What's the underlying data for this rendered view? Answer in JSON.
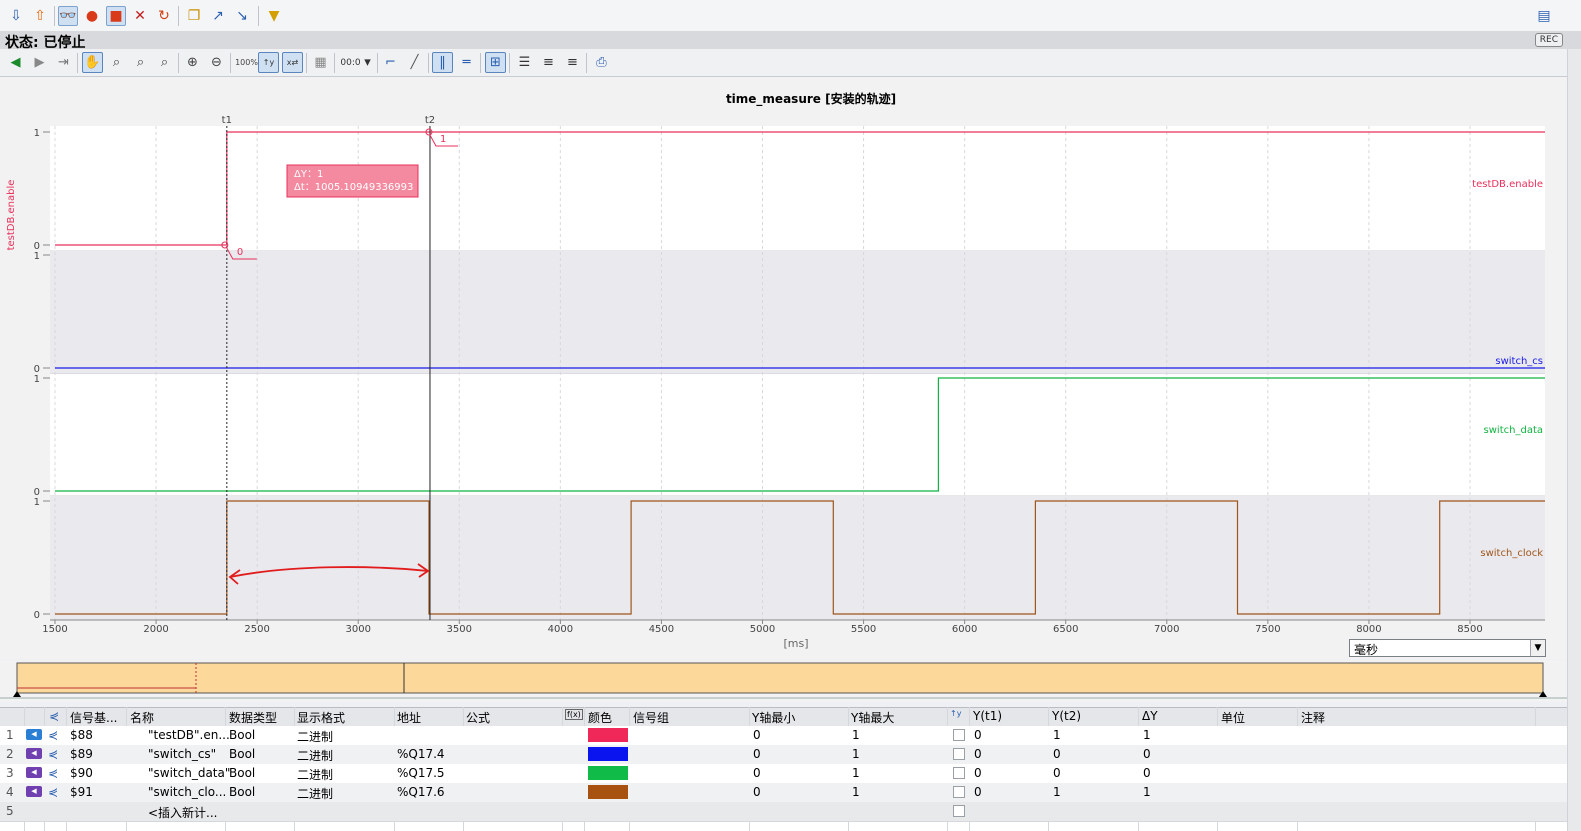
{
  "status": {
    "label": "状态: 已停止",
    "rec": "REC"
  },
  "chart": {
    "title": "time_measure [安装的轨迹]",
    "xunit": "[ms]",
    "yaxis_label": "testDB.enable",
    "x_ticks": [
      "1500",
      "2000",
      "2500",
      "3000",
      "3500",
      "4000",
      "4500",
      "5000",
      "5500",
      "6000",
      "6500",
      "7000",
      "7500",
      "8000",
      "8500"
    ],
    "cursor_t1": "t1",
    "cursor_t2": "t2",
    "t1_value": "0",
    "t2_value": "1",
    "tooltip_dy": "ΔY：1",
    "tooltip_dt": "Δt：1005.10949336993",
    "lane_ticks": {
      "one": "1",
      "zero": "0"
    },
    "signals": [
      {
        "name": "testDB.enable",
        "color": "#e8305b"
      },
      {
        "name": "switch_cs",
        "color": "#1a1ae6"
      },
      {
        "name": "switch_data",
        "color": "#10b540"
      },
      {
        "name": "switch_clock",
        "color": "#a0561a"
      }
    ],
    "unit_select": "毫秒"
  },
  "chart_data": {
    "type": "line",
    "title": "time_measure [安装的轨迹]",
    "xlabel": "[ms]",
    "xlim": [
      1500,
      8900
    ],
    "series": [
      {
        "name": "testDB.enable",
        "x": [
          1500,
          2350,
          2350,
          8900
        ],
        "y": [
          0,
          0,
          1,
          1
        ]
      },
      {
        "name": "switch_cs",
        "x": [
          1500,
          8900
        ],
        "y": [
          0,
          0
        ]
      },
      {
        "name": "switch_data",
        "x": [
          1500,
          5870,
          5870,
          8900
        ],
        "y": [
          0,
          0,
          1,
          1
        ]
      },
      {
        "name": "switch_clock",
        "x": [
          1500,
          2350,
          2350,
          3350,
          3350,
          4350,
          4350,
          5350,
          5350,
          6350,
          6350,
          7350,
          7350,
          8350,
          8350,
          8900
        ],
        "y": [
          0,
          0,
          1,
          1,
          0,
          0,
          1,
          1,
          0,
          0,
          1,
          1,
          0,
          0,
          1,
          1
        ]
      }
    ],
    "cursors": {
      "t1": 2350,
      "t2": 3355
    },
    "delta": {
      "dy": 1,
      "dt": 1005.10949336993
    }
  },
  "table": {
    "headers": [
      "信号基...",
      "名称",
      "数据类型",
      "显示格式",
      "地址",
      "公式",
      "颜色",
      "信号组",
      "Y轴最小",
      "Y轴最大",
      "Y(t1)",
      "Y(t2)",
      "ΔY",
      "单位",
      "注释"
    ],
    "rows": [
      {
        "num": "1",
        "id": "$88",
        "name": "\"testDB\".en...",
        "type": "Bool",
        "fmt": "二进制",
        "addr": "",
        "color": "#f0285a",
        "ymin": "0",
        "ymax": "1",
        "yt1": "0",
        "yt2": "1",
        "dy": "1"
      },
      {
        "num": "2",
        "id": "$89",
        "name": "\"switch_cs\"",
        "type": "Bool",
        "fmt": "二进制",
        "addr": "%Q17.4",
        "color": "#0a14ee",
        "ymin": "0",
        "ymax": "1",
        "yt1": "0",
        "yt2": "0",
        "dy": "0"
      },
      {
        "num": "3",
        "id": "$90",
        "name": "\"switch_data\"",
        "type": "Bool",
        "fmt": "二进制",
        "addr": "%Q17.5",
        "color": "#10bb48",
        "ymin": "0",
        "ymax": "1",
        "yt1": "0",
        "yt2": "0",
        "dy": "0"
      },
      {
        "num": "4",
        "id": "$91",
        "name": "\"switch_clo...",
        "type": "Bool",
        "fmt": "二进制",
        "addr": "%Q17.6",
        "color": "#a85212",
        "ymin": "0",
        "ymax": "1",
        "yt1": "0",
        "yt2": "1",
        "dy": "1"
      }
    ],
    "new_row": {
      "num": "5",
      "label": "<插入新计..."
    }
  }
}
